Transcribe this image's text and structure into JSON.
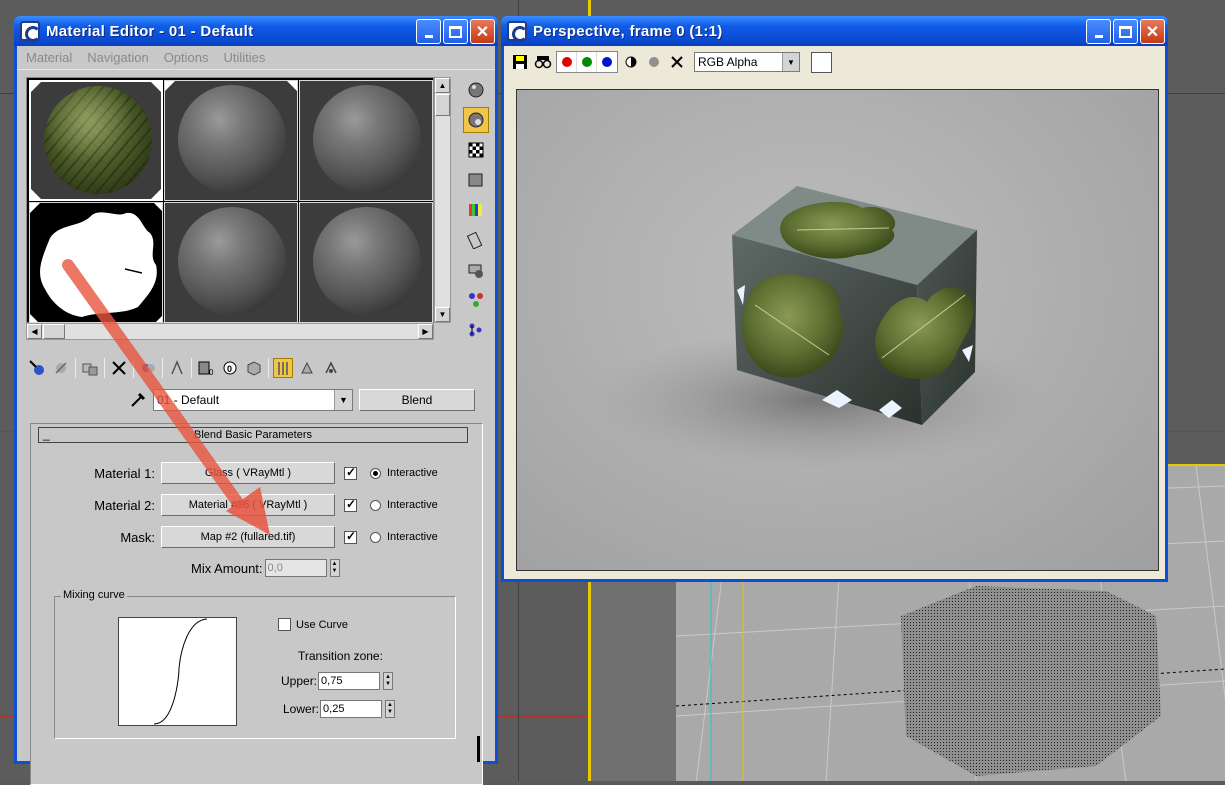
{
  "material_editor": {
    "title": "Material Editor - 01 - Default",
    "menu": [
      "Material",
      "Navigation",
      "Options",
      "Utilities"
    ],
    "material_name": "01 - Default",
    "material_type": "Blend",
    "rollout_title": "Blend Basic Parameters",
    "rollout_toggle": "_",
    "params": [
      {
        "label": "Material 1:",
        "value": "Glass  ( VRayMtl )",
        "checked": true,
        "radio_on": true,
        "radio_label": "Interactive"
      },
      {
        "label": "Material 2:",
        "value": "Material #26  ( VRayMtl )",
        "checked": true,
        "radio_on": false,
        "radio_label": "Interactive"
      },
      {
        "label": "Mask:",
        "value": "Map #2 (fullared.tif)",
        "checked": true,
        "radio_on": false,
        "radio_label": "Interactive"
      }
    ],
    "mix_amount_label": "Mix Amount:",
    "mix_amount_value": "0,0",
    "mixing_curve_title": "Mixing curve",
    "use_curve_label": "Use Curve",
    "use_curve_checked": false,
    "transition_zone_label": "Transition zone:",
    "upper_label": "Upper:",
    "upper_value": "0,75",
    "lower_label": "Lower:",
    "lower_value": "0,25"
  },
  "frame_window": {
    "title": "Perspective, frame 0 (1:1)",
    "channel_select": "RGB Alpha"
  },
  "colors": {
    "titlebar": "#0a48d0",
    "annotation_arrow": "#e8553f",
    "viewport_highlight": "#e8c800"
  }
}
